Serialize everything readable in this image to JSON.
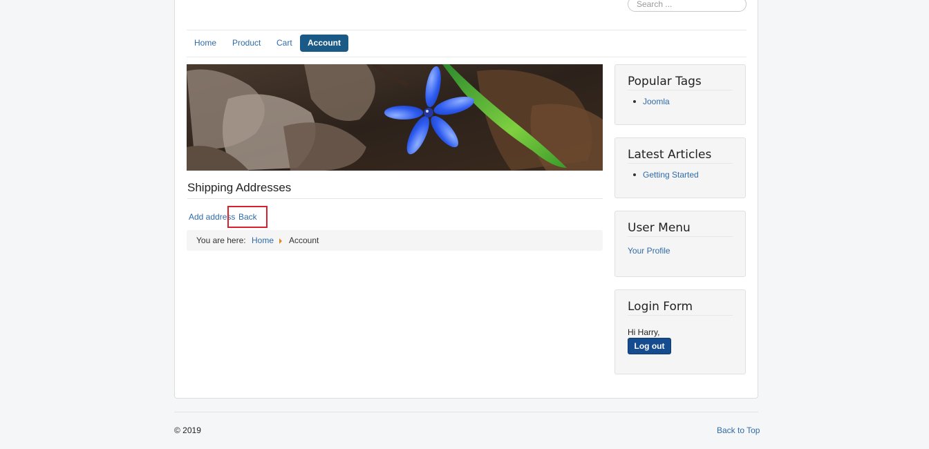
{
  "search": {
    "placeholder": "Search ..."
  },
  "nav": {
    "items": [
      {
        "label": "Home",
        "active": false
      },
      {
        "label": "Product",
        "active": false
      },
      {
        "label": "Cart",
        "active": false
      },
      {
        "label": "Account",
        "active": true
      }
    ]
  },
  "main": {
    "heading": "Shipping Addresses",
    "actions": {
      "add_label": "Add address",
      "back_label": "Back"
    },
    "breadcrumb": {
      "prefix": "You are here:",
      "home": "Home",
      "current": "Account"
    }
  },
  "sidebar": {
    "popular_tags": {
      "title": "Popular Tags",
      "items": [
        "Joomla"
      ]
    },
    "latest_articles": {
      "title": "Latest Articles",
      "items": [
        "Getting Started"
      ]
    },
    "user_menu": {
      "title": "User Menu",
      "items": [
        "Your Profile"
      ]
    },
    "login_form": {
      "title": "Login Form",
      "greeting": "Hi Harry,",
      "logout_label": "Log out"
    }
  },
  "footer": {
    "copyright": "© 2019",
    "back_to_top": "Back to Top"
  },
  "colors": {
    "accent": "#1b5987",
    "link": "#2f6aa8",
    "logout_button": "#154b8f",
    "highlight": "#d8202c",
    "breadcrumb_separator": "#e08a1e"
  }
}
